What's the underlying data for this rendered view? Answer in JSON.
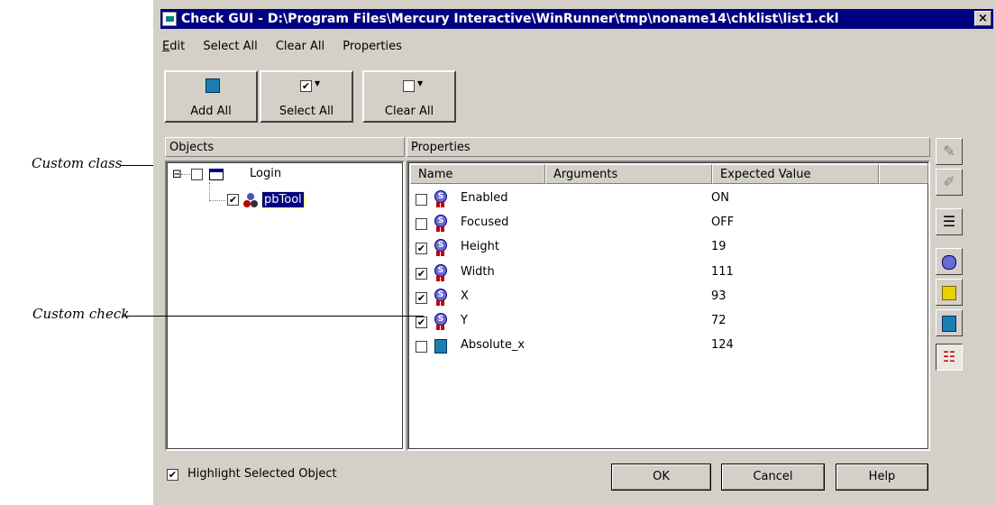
{
  "callouts": {
    "custom_class": "Custom class",
    "custom_check": "Custom check"
  },
  "window": {
    "title": "Check GUI - D:\\Program Files\\Mercury Interactive\\WinRunner\\tmp\\noname14\\chklist\\list1.ckl",
    "close_label": "×"
  },
  "menu": {
    "items": [
      "Edit",
      "Select All",
      "Clear All",
      "Properties"
    ]
  },
  "toolbar": {
    "add_all": "Add All",
    "select_all": "Select All",
    "clear_all": "Clear All"
  },
  "objects_panel": {
    "header": "Objects",
    "tree": [
      {
        "label": "Login",
        "checked": false,
        "expander": "⊟"
      },
      {
        "label": "pbTool",
        "checked": true,
        "selected": true
      }
    ]
  },
  "properties_panel": {
    "header": "Properties",
    "columns": [
      "Name",
      "Arguments",
      "Expected Value"
    ],
    "rows": [
      {
        "name": "Enabled",
        "value": "ON",
        "checked": false,
        "icon": "seal-icon"
      },
      {
        "name": "Focused",
        "value": "OFF",
        "checked": false,
        "icon": "seal-icon"
      },
      {
        "name": "Height",
        "value": "19",
        "checked": true,
        "icon": "seal-icon"
      },
      {
        "name": "Width",
        "value": "111",
        "checked": true,
        "icon": "seal-icon"
      },
      {
        "name": "X",
        "value": "93",
        "checked": true,
        "icon": "seal-icon"
      },
      {
        "name": "Y",
        "value": "72",
        "checked": true,
        "icon": "seal-icon"
      },
      {
        "name": "Absolute_x",
        "value": "124",
        "checked": false,
        "icon": "cube-icon"
      }
    ]
  },
  "side_toolbar": {
    "icons": [
      "edit-note-icon",
      "edit-args-icon",
      "checklist-icon",
      "seal-icon",
      "hierarchy-icon",
      "cube-icon",
      "list-detail-icon"
    ]
  },
  "footer": {
    "highlight_label": "Highlight Selected Object",
    "highlight_checked": true,
    "ok": "OK",
    "cancel": "Cancel",
    "help": "Help"
  },
  "colors": {
    "title_bar": "#000080",
    "dialog_face": "#d4d0c8",
    "selection": "#000080"
  }
}
